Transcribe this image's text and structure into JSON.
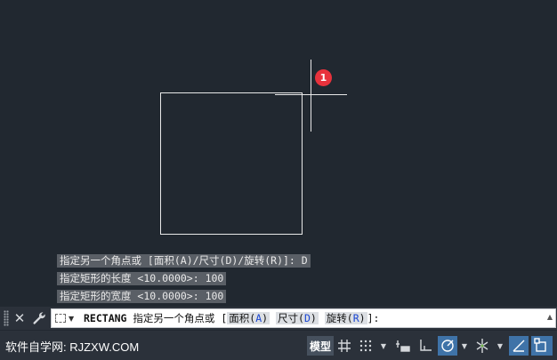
{
  "drawing": {
    "callout_number": "1"
  },
  "command_history": [
    "指定另一个角点或 [面积(A)/尺寸(D)/旋转(R)]: D",
    "指定矩形的长度 <10.0000>: 100",
    "指定矩形的宽度 <10.0000>: 100"
  ],
  "command_line": {
    "command": "RECTANG",
    "prompt": " 指定另一个角点或 [",
    "options": [
      {
        "text": "面积(",
        "key": "A",
        "close": ")"
      },
      {
        "text": "尺寸(",
        "key": "D",
        "close": ")"
      },
      {
        "text": "旋转(",
        "key": "R",
        "close": ")"
      }
    ],
    "suffix": "]:"
  },
  "status_bar": {
    "watermark": "软件自学网: RJZXW.COM",
    "model_tab": "模型"
  },
  "colors": {
    "canvas": "#212830",
    "callout": "#e8323c",
    "option_key": "#1a46d2",
    "active_toggle": "#3f73a8"
  }
}
